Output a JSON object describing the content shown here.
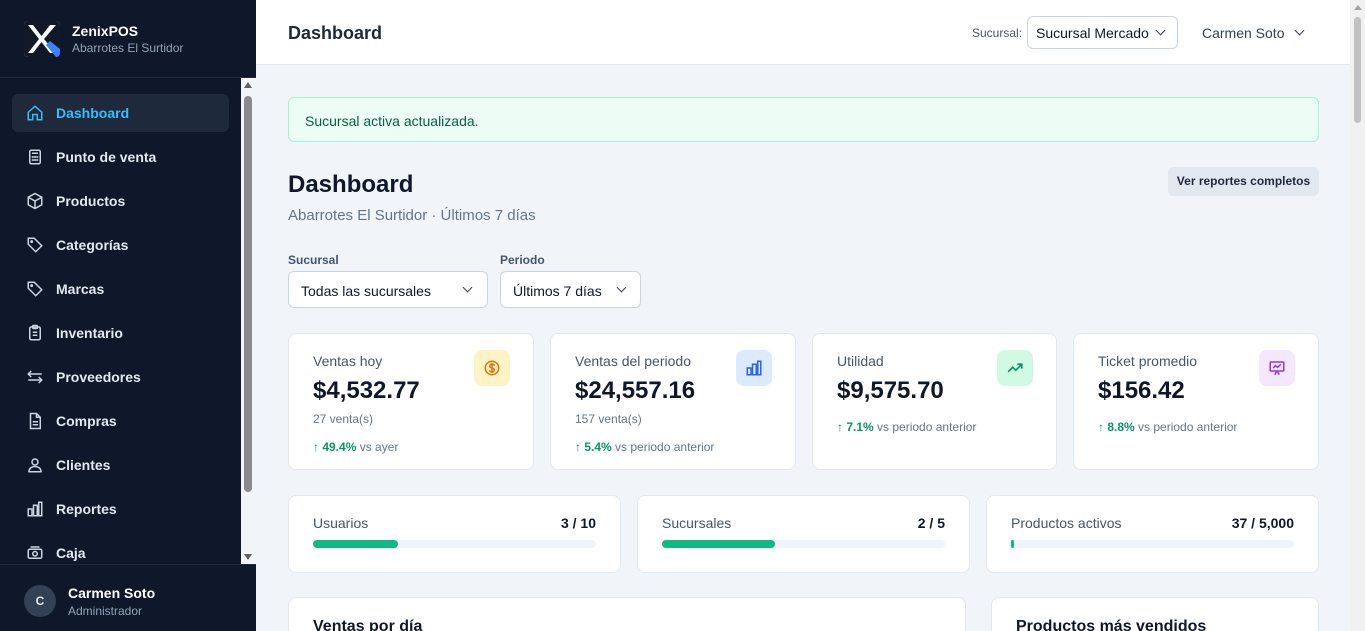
{
  "app": {
    "name": "ZenixPOS",
    "store": "Abarrotes El Surtidor"
  },
  "sidebar": {
    "items": [
      {
        "label": "Dashboard",
        "icon": "home-icon",
        "active": true
      },
      {
        "label": "Punto de venta",
        "icon": "calculator-icon"
      },
      {
        "label": "Productos",
        "icon": "box-icon"
      },
      {
        "label": "Categorías",
        "icon": "tag-icon"
      },
      {
        "label": "Marcas",
        "icon": "tag-icon"
      },
      {
        "label": "Inventario",
        "icon": "clipboard-icon"
      },
      {
        "label": "Proveedores",
        "icon": "arrows-exchange-icon"
      },
      {
        "label": "Compras",
        "icon": "document-icon"
      },
      {
        "label": "Clientes",
        "icon": "users-icon"
      },
      {
        "label": "Reportes",
        "icon": "bar-chart-icon"
      },
      {
        "label": "Caja",
        "icon": "cash-icon"
      }
    ],
    "user": {
      "initial": "C",
      "name": "Carmen Soto",
      "role": "Administrador"
    }
  },
  "header": {
    "title": "Dashboard",
    "branch_label": "Sucursal:",
    "branch_value": "Sucursal Mercado",
    "user_name": "Carmen Soto"
  },
  "alert": {
    "message": "Sucursal activa actualizada."
  },
  "page": {
    "title": "Dashboard",
    "subtitle": "Abarrotes El Surtidor · Últimos 7 días",
    "reports_button": "Ver reportes completos"
  },
  "filters": {
    "branch": {
      "label": "Sucursal",
      "value": "Todas las sucursales"
    },
    "period": {
      "label": "Periodo",
      "value": "Últimos 7 días"
    }
  },
  "kpis": [
    {
      "label": "Ventas hoy",
      "value": "$4,532.77",
      "count": "27 venta(s)",
      "delta": "↑ 49.4%",
      "delta_text": "vs ayer",
      "icon": "dollar-coin-icon",
      "icon_bg": "#fef3c7",
      "icon_color": "#d97706"
    },
    {
      "label": "Ventas del periodo",
      "value": "$24,557.16",
      "count": "157 venta(s)",
      "delta": "↑ 5.4%",
      "delta_text": "vs periodo anterior",
      "icon": "bar-chart-icon",
      "icon_bg": "#dbeafe",
      "icon_color": "#2563eb"
    },
    {
      "label": "Utilidad",
      "value": "$9,575.70",
      "count": "",
      "delta": "↑ 7.1%",
      "delta_text": "vs periodo anterior",
      "icon": "trending-up-icon",
      "icon_bg": "#d1fae5",
      "icon_color": "#059669"
    },
    {
      "label": "Ticket promedio",
      "value": "$156.42",
      "count": "",
      "delta": "↑ 8.8%",
      "delta_text": "vs periodo anterior",
      "icon": "presentation-chart-icon",
      "icon_bg": "#f3e8ff",
      "icon_color": "#9333ea"
    }
  ],
  "usage": [
    {
      "label": "Usuarios",
      "value": "3 / 10",
      "fraction": 0.3
    },
    {
      "label": "Sucursales",
      "value": "2 / 5",
      "fraction": 0.4
    },
    {
      "label": "Productos activos",
      "value": "37 / 5,000",
      "fraction": 0.0074
    }
  ],
  "sections": {
    "sales_by_day": "Ventas por día",
    "top_products": "Productos más vendidos"
  },
  "colors": {
    "sidebar_bg": "#0f172a",
    "accent": "#38bdf8",
    "success": "#10b981"
  }
}
